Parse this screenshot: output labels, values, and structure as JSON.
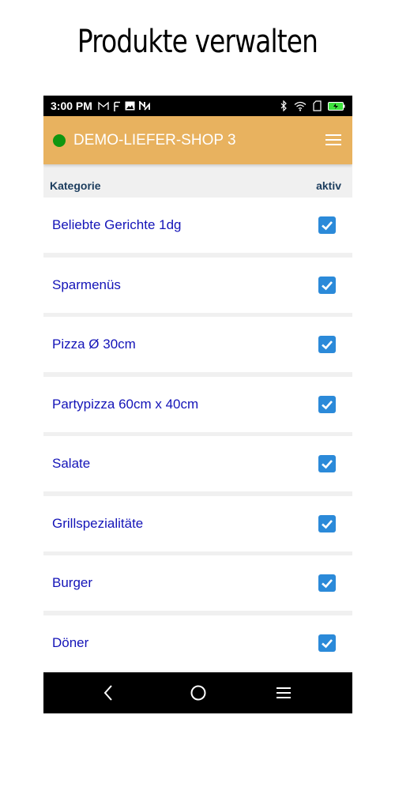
{
  "page": {
    "title": "Produkte verwalten"
  },
  "status_bar": {
    "time": "3:00 PM",
    "left_icons": [
      "gmail-icon",
      "f-icon",
      "image-icon",
      "n-icon"
    ],
    "right_icons": [
      "bluetooth-icon",
      "wifi-icon",
      "sim-icon",
      "battery-icon"
    ],
    "battery_color": "#3ee23e"
  },
  "header": {
    "shop_name": "DEMO-LIEFER-SHOP 3",
    "status_color": "#109610",
    "background": "#e8b25f"
  },
  "table": {
    "col_category": "Kategorie",
    "col_active": "aktiv",
    "rows": [
      {
        "label": "Beliebte Gerichte 1dg",
        "active": true
      },
      {
        "label": "Sparmenüs",
        "active": true
      },
      {
        "label": "Pizza Ø 30cm",
        "active": true
      },
      {
        "label": "Partypizza 60cm x 40cm",
        "active": true
      },
      {
        "label": "Salate",
        "active": true
      },
      {
        "label": "Grillspezialitäte",
        "active": true
      },
      {
        "label": "Burger",
        "active": true
      },
      {
        "label": "Döner",
        "active": true
      }
    ]
  },
  "nav_bar": {
    "buttons": [
      "back-icon",
      "home-icon",
      "recents-icon"
    ]
  }
}
